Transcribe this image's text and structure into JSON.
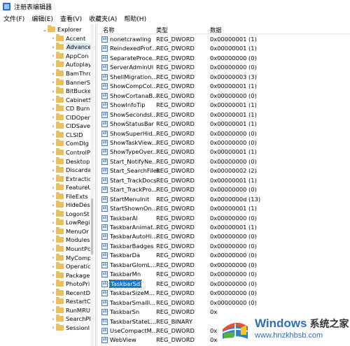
{
  "window": {
    "title": "注册表编辑器"
  },
  "menu": [
    "文件(F)",
    "编辑(E)",
    "查看(V)",
    "收藏夹(A)",
    "帮助(H)"
  ],
  "tree": {
    "parent": "Explorer",
    "items": [
      "Accent",
      "Advance",
      "AppCon",
      "Autoplay",
      "BamThro",
      "BannerS",
      "BitBucke",
      "CabinetS",
      "CD Burn",
      "CIDOpen",
      "CIDSave",
      "CLSID",
      "ComDlg",
      "ControlP",
      "Desktop",
      "Discarda",
      "Extractic",
      "FeatureU",
      "FileExts",
      "HideDes",
      "LogonSt",
      "LowRegi",
      "MenuOr",
      "Modules",
      "MountPc",
      "MyComp",
      "Operatic",
      "Package",
      "PhotoPri",
      "RecentD",
      "RestartC",
      "RunMRU",
      "SearchPl",
      "SessionI"
    ],
    "selected_index": 1
  },
  "list": {
    "headers": {
      "name": "名称",
      "type": "类型",
      "data": "数据"
    },
    "rows": [
      {
        "name": "nonetcrawling",
        "type": "REG_DWORD",
        "data": "0x00000001 (1)"
      },
      {
        "name": "ReindexedProf...",
        "type": "REG_DWORD",
        "data": "0x00000001 (1)"
      },
      {
        "name": "SeparateProce...",
        "type": "REG_DWORD",
        "data": "0x00000000 (0)"
      },
      {
        "name": "ServerAdminUI",
        "type": "REG_DWORD",
        "data": "0x00000000 (0)"
      },
      {
        "name": "ShellMigration...",
        "type": "REG_DWORD",
        "data": "0x00000003 (3)"
      },
      {
        "name": "ShowCompCol...",
        "type": "REG_DWORD",
        "data": "0x00000001 (1)"
      },
      {
        "name": "ShowCortanaB...",
        "type": "REG_DWORD",
        "data": "0x00000000 (0)"
      },
      {
        "name": "ShowInfoTip",
        "type": "REG_DWORD",
        "data": "0x00000001 (1)"
      },
      {
        "name": "ShowSecondsI...",
        "type": "REG_DWORD",
        "data": "0x00000001 (1)"
      },
      {
        "name": "ShowStatusBar",
        "type": "REG_DWORD",
        "data": "0x00000001 (1)"
      },
      {
        "name": "ShowSuperHid...",
        "type": "REG_DWORD",
        "data": "0x00000000 (0)"
      },
      {
        "name": "ShowTaskView...",
        "type": "REG_DWORD",
        "data": "0x00000000 (0)"
      },
      {
        "name": "ShowTypeOver...",
        "type": "REG_DWORD",
        "data": "0x00000001 (1)"
      },
      {
        "name": "Start_NotifyNe...",
        "type": "REG_DWORD",
        "data": "0x00000000 (0)"
      },
      {
        "name": "Start_SearchFiles",
        "type": "REG_DWORD",
        "data": "0x00000002 (2)"
      },
      {
        "name": "Start_TrackDocs",
        "type": "REG_DWORD",
        "data": "0x00000001 (1)"
      },
      {
        "name": "Start_TrackPro...",
        "type": "REG_DWORD",
        "data": "0x00000000 (0)"
      },
      {
        "name": "StartMenuInit",
        "type": "REG_DWORD",
        "data": "0x0000000d (13)"
      },
      {
        "name": "StartShownOn...",
        "type": "REG_DWORD",
        "data": "0x00000001 (1)"
      },
      {
        "name": "TaskbarAl",
        "type": "REG_DWORD",
        "data": "0x00000000 (0)"
      },
      {
        "name": "TaskbarAnimat...",
        "type": "REG_DWORD",
        "data": "0x00000001 (1)"
      },
      {
        "name": "TaskbarAutoHi...",
        "type": "REG_DWORD",
        "data": "0x00000000 (0)"
      },
      {
        "name": "TaskbarBadges",
        "type": "REG_DWORD",
        "data": "0x00000000 (0)"
      },
      {
        "name": "TaskbarDa",
        "type": "REG_DWORD",
        "data": "0x00000000 (0)"
      },
      {
        "name": "TaskbarGlomL...",
        "type": "REG_DWORD",
        "data": "0x00000000 (0)"
      },
      {
        "name": "TaskbarMn",
        "type": "REG_DWORD",
        "data": "0x00000000 (0)"
      },
      {
        "name": "TaskbarSd",
        "type": "REG_DWORD",
        "data": "0x00000000 (0)"
      },
      {
        "name": "TaskbarSizeM...",
        "type": "REG_DWORD",
        "data": "0x00000000 (0)"
      },
      {
        "name": "TaskbarSmallI...",
        "type": "REG_DWORD",
        "data": "0x00000000 (0)"
      },
      {
        "name": "TaskbarSn",
        "type": "REG_DWORD",
        "data": "0x"
      },
      {
        "name": "TaskbarStateL...",
        "type": "REG_BINARY",
        "data": ""
      },
      {
        "name": "UseCompactM...",
        "type": "REG_DWORD",
        "data": "0x"
      },
      {
        "name": "WebView",
        "type": "REG_DWORD",
        "data": "0x"
      }
    ],
    "selected_index": 26
  },
  "watermark": {
    "brand": "Windows",
    "cn": "系统之家",
    "url": "www.hnzkhbsb.com"
  },
  "colors": {
    "selection": "#0078d7",
    "folder": "#e8c05d",
    "brand": "#2a6fb7"
  }
}
